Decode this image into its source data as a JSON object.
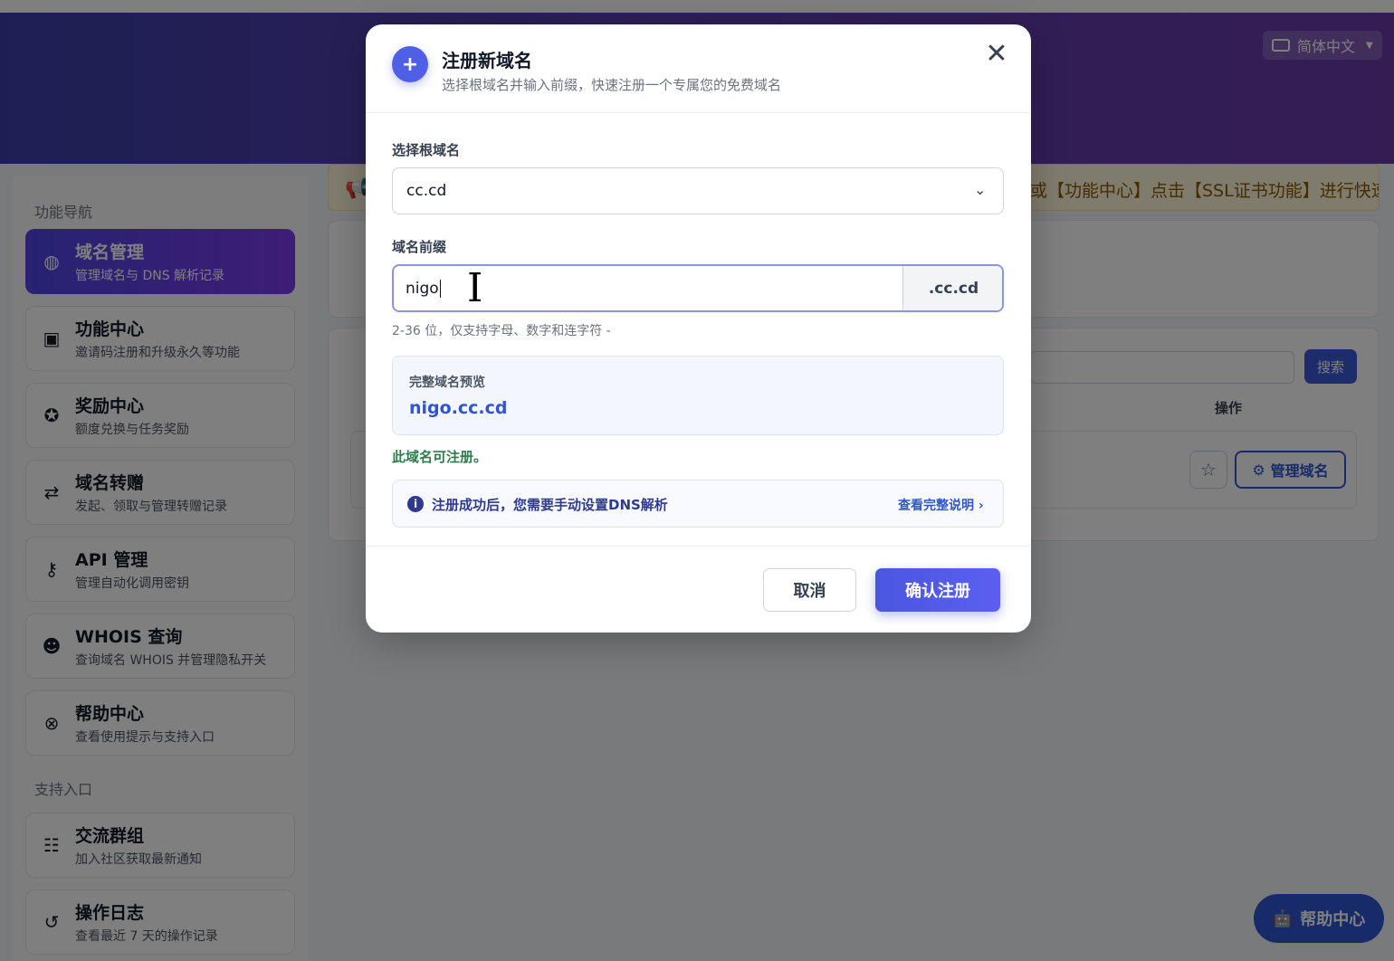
{
  "header": {
    "language": "简体中文"
  },
  "sidebar": {
    "nav_heading": "功能导航",
    "items": [
      {
        "title": "域名管理",
        "desc": "管理域名与 DNS 解析记录",
        "icon": "globe-icon"
      },
      {
        "title": "功能中心",
        "desc": "邀请码注册和升级永久等功能",
        "icon": "toolbox-icon"
      },
      {
        "title": "奖励中心",
        "desc": "额度兑换与任务奖励",
        "icon": "award-icon"
      },
      {
        "title": "域名转赠",
        "desc": "发起、领取与管理转赠记录",
        "icon": "transfer-icon"
      },
      {
        "title": "API 管理",
        "desc": "管理自动化调用密钥",
        "icon": "key-icon"
      },
      {
        "title": "WHOIS 查询",
        "desc": "查询域名 WHOIS 并管理隐私开关",
        "icon": "user-lock-icon"
      },
      {
        "title": "帮助中心",
        "desc": "查看使用提示与支持入口",
        "icon": "lifebuoy-icon"
      }
    ],
    "support_heading": "支持入口",
    "support_items": [
      {
        "title": "交流群组",
        "desc": "加入社区获取最新通知",
        "icon": "group-icon"
      },
      {
        "title": "操作日志",
        "desc": "查看最近 7 天的操作记录",
        "icon": "history-icon"
      }
    ]
  },
  "notice": {
    "text": "或【功能中心】点击【SSL证书功能】进行快速"
  },
  "main": {
    "search_label": "搜索",
    "column_operation": "操作",
    "manage_label": "管理域名"
  },
  "help_fab": "帮助中心",
  "modal": {
    "title": "注册新域名",
    "subtitle": "选择根域名并输入前缀，快速注册一个专属您的免费域名",
    "root_label": "选择根域名",
    "root_value": "cc.cd",
    "prefix_label": "域名前缀",
    "prefix_value": "nigo",
    "suffix": ".cc.cd",
    "hint": "2-36 位，仅支持字母、数字和连字符 -",
    "preview_label": "完整域名预览",
    "preview_value": "nigo.cc.cd",
    "available": "此域名可注册。",
    "info_text": "注册成功后，您需要手动设置DNS解析",
    "info_link": "查看完整说明",
    "cancel": "取消",
    "confirm": "确认注册"
  }
}
